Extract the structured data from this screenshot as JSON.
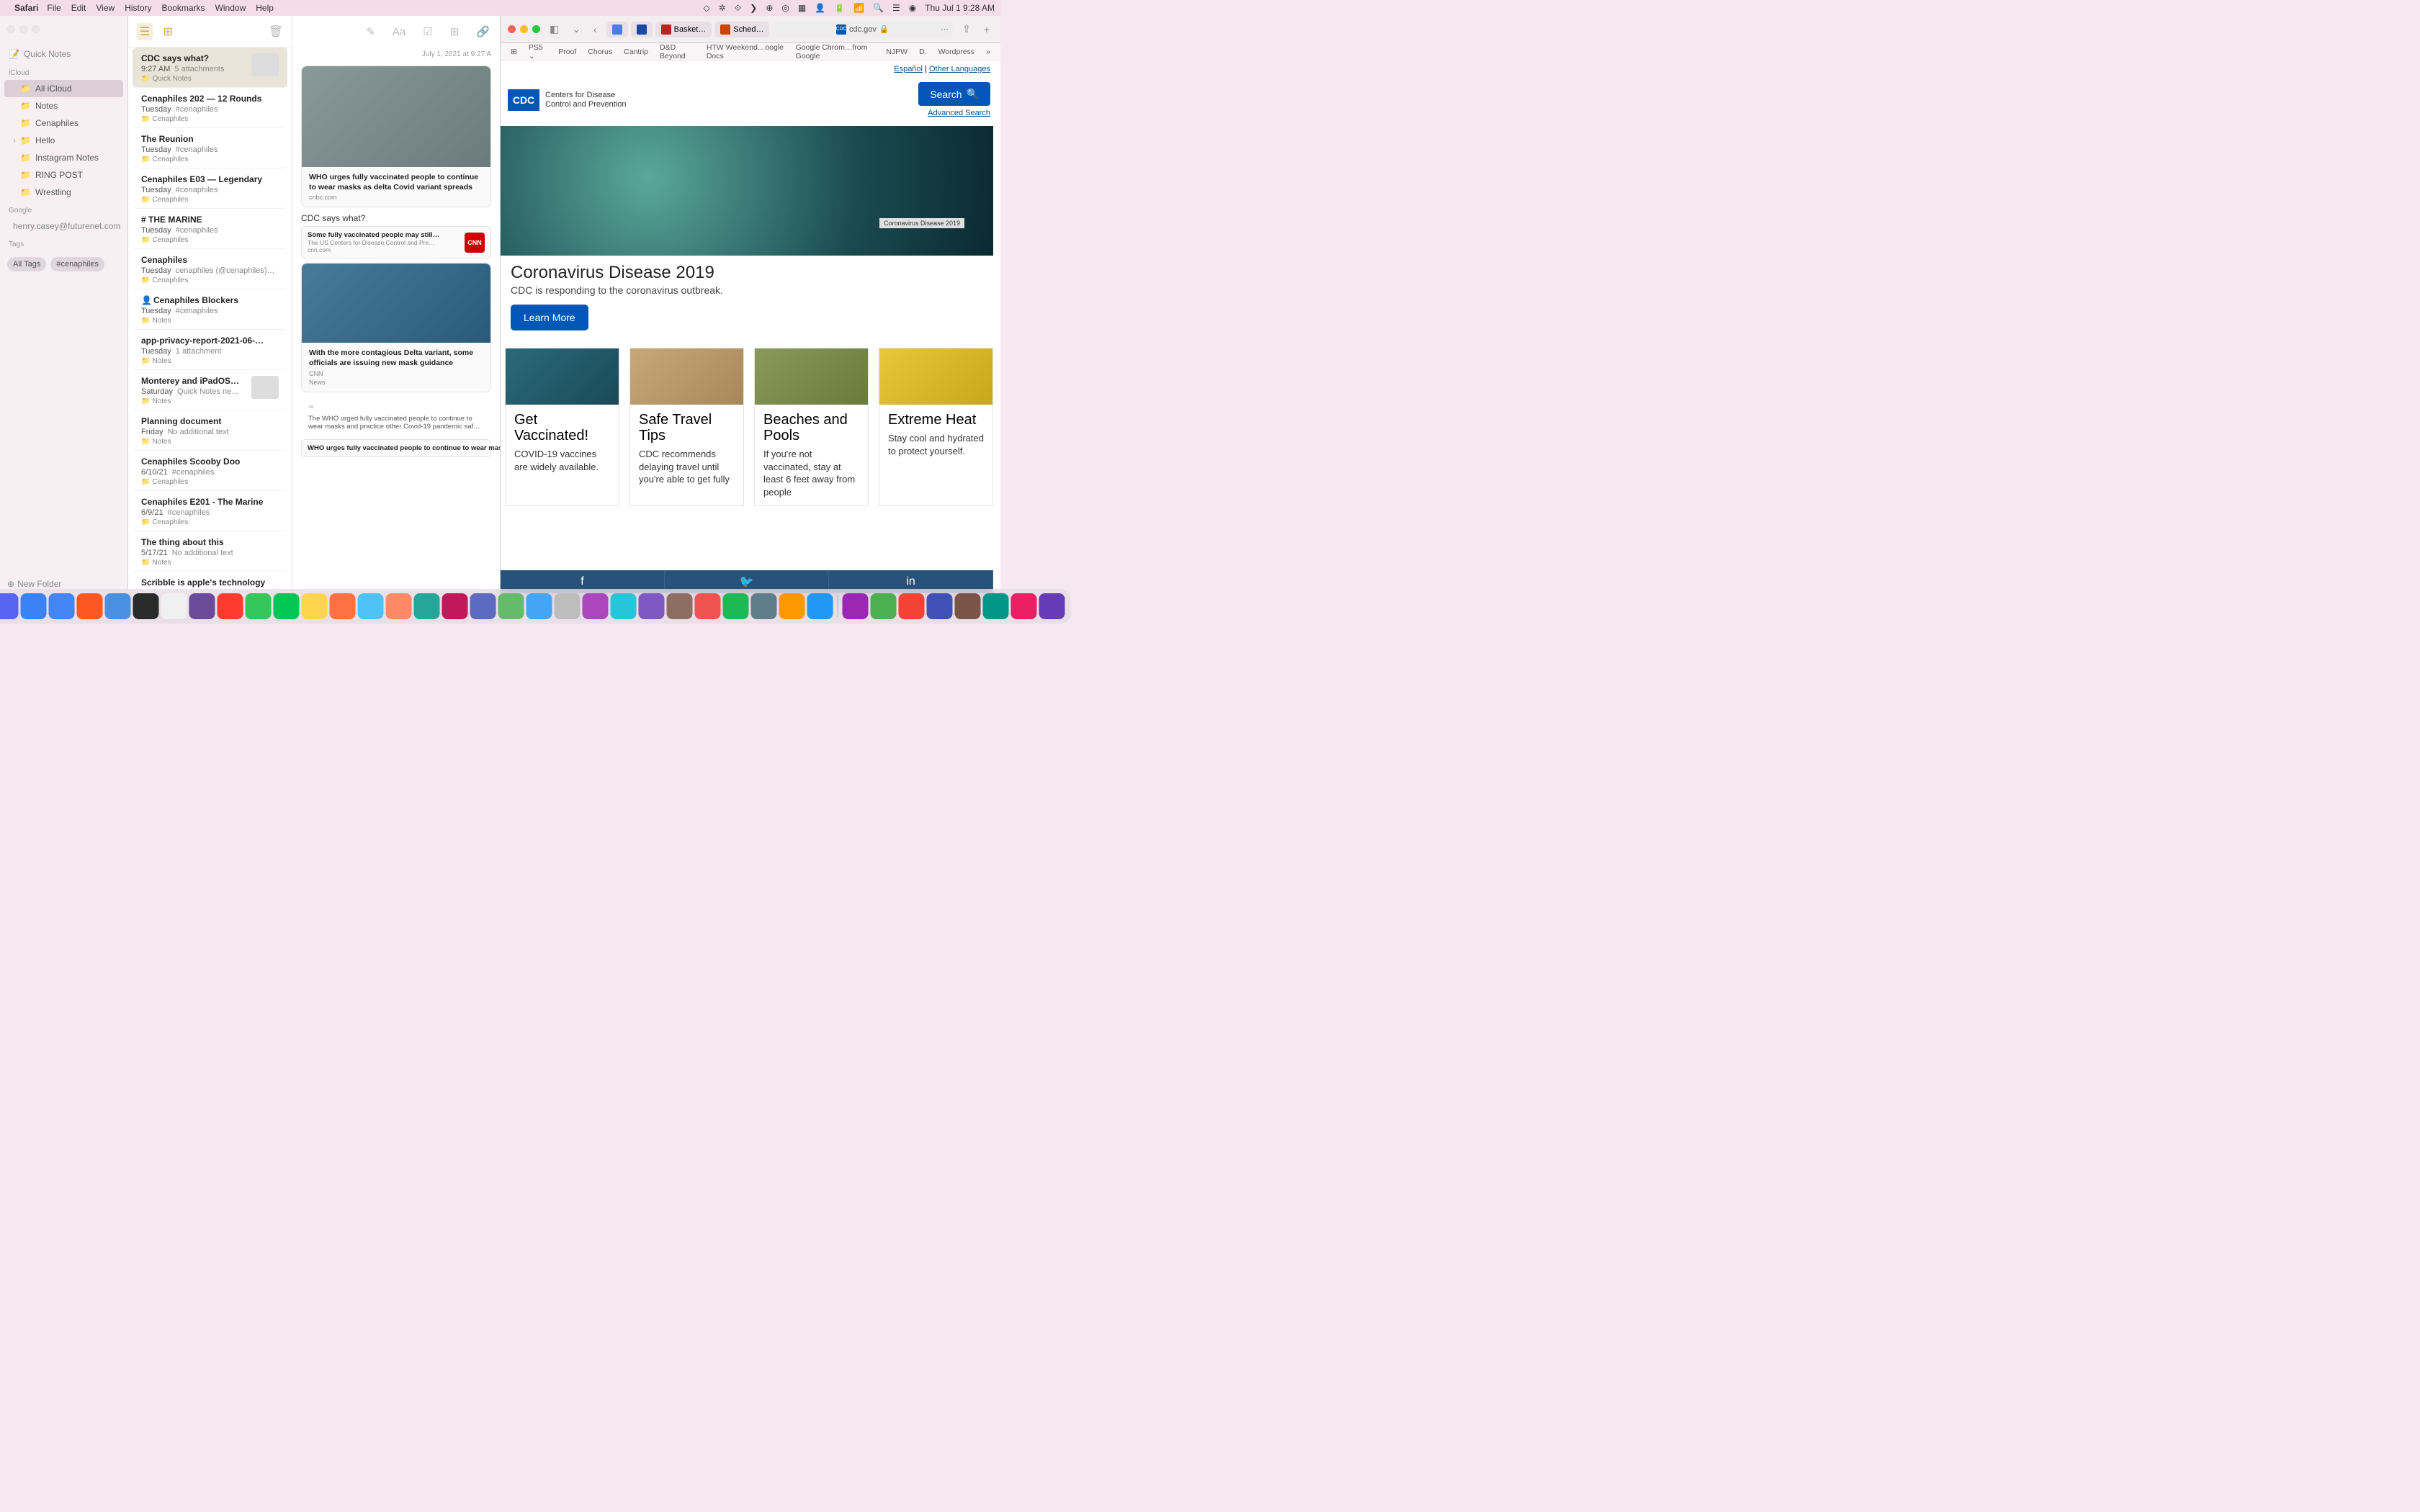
{
  "menubar": {
    "app": "Safari",
    "items": [
      "File",
      "Edit",
      "View",
      "History",
      "Bookmarks",
      "Window",
      "Help"
    ],
    "clock": "Thu Jul 1  9:28 AM"
  },
  "notes": {
    "quick_notes": "Quick Notes",
    "sections": {
      "icloud": "iCloud",
      "google": "Google",
      "tags": "Tags"
    },
    "folders": [
      "All iCloud",
      "Notes",
      "Cenaphiles",
      "Hello",
      "Instagram Notes",
      "RING POST",
      "Wrestling"
    ],
    "google_email": "henry.casey@futurenet.com",
    "tags_list": [
      "All Tags",
      "#cenaphiles"
    ],
    "new_folder": "New Folder",
    "list": [
      {
        "title": "CDC says what?",
        "date": "9:27 AM",
        "preview": "5 attachments",
        "folder": "Quick Notes",
        "thumb": true,
        "sel": true
      },
      {
        "title": "Cenaphiles 202 — 12 Rounds",
        "date": "Tuesday",
        "preview": "#cenaphiles",
        "folder": "Cenaphiles"
      },
      {
        "title": "The Reunion",
        "date": "Tuesday",
        "preview": "#cenaphiles",
        "folder": "Cenaphiles"
      },
      {
        "title": "Cenaphiles E03 — Legendary",
        "date": "Tuesday",
        "preview": "#cenaphiles",
        "folder": "Cenaphiles"
      },
      {
        "title": "# THE MARINE",
        "date": "Tuesday",
        "preview": "#cenaphiles",
        "folder": "Cenaphiles"
      },
      {
        "title": "Cenaphiles",
        "date": "Tuesday",
        "preview": "cenaphiles (@cenaphiles)…",
        "folder": "Cenaphiles"
      },
      {
        "title": "Cenaphiles Blockers",
        "date": "Tuesday",
        "preview": "#cenaphiles",
        "folder": "Notes",
        "shared": true
      },
      {
        "title": "app-privacy-report-2021-06-…",
        "date": "Tuesday",
        "preview": "1 attachment",
        "folder": "Notes"
      },
      {
        "title": "Monterey and iPadOS…",
        "date": "Saturday",
        "preview": "Quick Notes ne…",
        "folder": "Notes",
        "thumb": true
      },
      {
        "title": "Planning document",
        "date": "Friday",
        "preview": "No additional text",
        "folder": "Notes"
      },
      {
        "title": "Cenaphiles Scooby Doo",
        "date": "6/10/21",
        "preview": "#cenaphiles",
        "folder": "Cenaphiles"
      },
      {
        "title": "Cenaphiles E201 - The Marine",
        "date": "6/9/21",
        "preview": "#cenaphiles",
        "folder": "Cenaphiles"
      },
      {
        "title": "The thing about this",
        "date": "5/17/21",
        "preview": "No additional text",
        "folder": "Notes"
      },
      {
        "title": "Scribble is apple's technology",
        "date": "",
        "preview": "",
        "folder": ""
      }
    ],
    "detail": {
      "date": "July 1, 2021 at 9:27 A",
      "card1": {
        "headline": "WHO urges fully vaccinated people to continue to wear masks as delta Covid variant spreads",
        "src": "cnbc.com"
      },
      "heading": "CDC says what?",
      "mini": {
        "h": "Some fully vaccinated people may still…",
        "s": "The US Centers for Disease Control and Pre…",
        "src": "cnn.com",
        "logo": "CNN"
      },
      "card2": {
        "headline": "With the more contagious Delta variant, some officials are issuing new mask guidance",
        "src2": "CNN",
        "src3": "News"
      },
      "quote": "The WHO urged fully vaccinated people to continue to wear masks and practice other Covid-19 pandemic saf…",
      "mini2": {
        "h": "WHO urges fully vaccinated people to continue to wear masks as delta Covid"
      }
    }
  },
  "safari": {
    "tabs": [
      {
        "label": "",
        "icon": "#4a7de0"
      },
      {
        "label": "",
        "icon": "#1a4aa0"
      },
      {
        "label": "Basket…",
        "icon": "#c02020"
      },
      {
        "label": "Sched…",
        "icon": "#d04000"
      }
    ],
    "address": "cdc.gov",
    "favorites": [
      "PS5 ⌄",
      "Proof",
      "Chorus",
      "Cantrip",
      "D&D Beyond",
      "HTW Weekend…oogle Docs",
      "Google Chrom…from Google",
      "NJPW",
      "D.",
      "Wordpress"
    ]
  },
  "cdc": {
    "espanol": "Español",
    "other_lang": "Other Languages",
    "sep": " | ",
    "logo_text": "CDC",
    "logo_name1": "Centers for Disease",
    "logo_name2": "Control and Prevention",
    "search": "Search",
    "adv_search": "Advanced Search",
    "hero_badge": "Coronavirus Disease 2019",
    "hero_title": "Coronavirus Disease 2019",
    "hero_sub": "CDC is responding to the coronavirus outbreak.",
    "learn_more": "Learn More",
    "cards": [
      {
        "title": "Get Vaccinated!",
        "body": "COVID-19 vaccines are widely available."
      },
      {
        "title": "Safe Travel Tips",
        "body": "CDC recommends delaying travel until you're able to get fully"
      },
      {
        "title": "Beaches and Pools",
        "body": "If you're not vaccinated, stay at least 6 feet away from people"
      },
      {
        "title": "Extreme Heat",
        "body": "Stay cool and hydrated to protect yourself."
      }
    ]
  },
  "dock_colors": [
    "#1e90ff",
    "#e74c3c",
    "#5865f2",
    "#3b82f6",
    "#4285f4",
    "#ff5722",
    "#4a90e2",
    "#2a2a2a",
    "#f0f0f0",
    "#6b4a9a",
    "#ff3b30",
    "#34c759",
    "#00c853",
    "#ffd54f",
    "#ff7043",
    "#4fc3f7",
    "#ff8a65",
    "#26a69a",
    "#c2185b",
    "#5c6bc0",
    "#66bb6a",
    "#42a5f5",
    "#bdbdbd",
    "#ab47bc",
    "#26c6da",
    "#7e57c2",
    "#8d6e63",
    "#ef5350",
    "#1db954",
    "#607d8b",
    "#ff9800",
    "#2196f3",
    "#9c27b0",
    "#4caf50",
    "#f44336",
    "#3f51b5",
    "#795548",
    "#009688",
    "#e91e63",
    "#673ab7"
  ]
}
